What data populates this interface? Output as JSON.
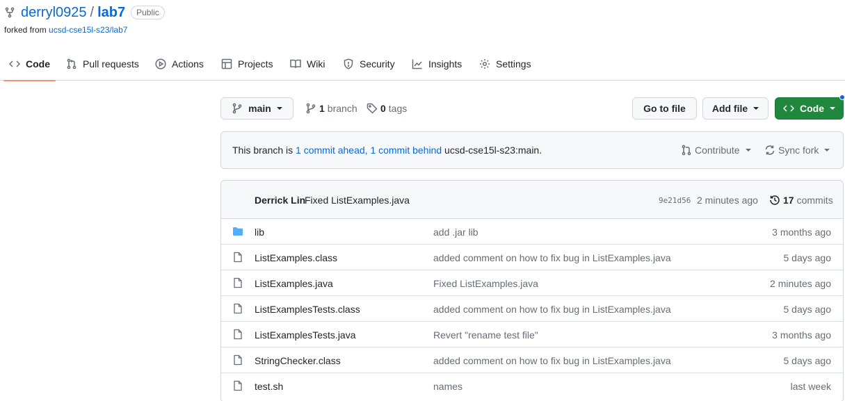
{
  "repo": {
    "owner": "derryl0925",
    "separator": "/",
    "name": "lab7",
    "visibility": "Public",
    "forked_prefix": "forked from",
    "forked_from": "ucsd-cse15l-s23/lab7"
  },
  "tabs": [
    {
      "label": "Code",
      "icon": "code-icon",
      "active": true
    },
    {
      "label": "Pull requests",
      "icon": "pull-request-icon"
    },
    {
      "label": "Actions",
      "icon": "play-icon"
    },
    {
      "label": "Projects",
      "icon": "table-icon"
    },
    {
      "label": "Wiki",
      "icon": "book-icon"
    },
    {
      "label": "Security",
      "icon": "shield-icon"
    },
    {
      "label": "Insights",
      "icon": "graph-icon"
    },
    {
      "label": "Settings",
      "icon": "gear-icon"
    }
  ],
  "toolbar": {
    "branch": "main",
    "branch_count": "1",
    "branch_label": "branch",
    "tag_count": "0",
    "tag_label": "tags",
    "go_to_file": "Go to file",
    "add_file": "Add file",
    "code": "Code"
  },
  "compare": {
    "prefix": "This branch is",
    "ahead": "1 commit ahead,",
    "behind": "1 commit behind",
    "upstream": "ucsd-cse15l-s23:main.",
    "contribute": "Contribute",
    "sync": "Sync fork"
  },
  "latest_commit": {
    "author": "Derrick Lin",
    "message": "Fixed ListExamples.java",
    "sha": "9e21d56",
    "time": "2 minutes ago",
    "commit_count": "17",
    "commit_label": "commits"
  },
  "files": [
    {
      "type": "dir",
      "name": "lib",
      "message": "add .jar lib",
      "age": "3 months ago"
    },
    {
      "type": "file",
      "name": "ListExamples.class",
      "message": "added comment on how to fix bug in ListExamples.java",
      "age": "5 days ago"
    },
    {
      "type": "file",
      "name": "ListExamples.java",
      "message": "Fixed ListExamples.java",
      "age": "2 minutes ago"
    },
    {
      "type": "file",
      "name": "ListExamplesTests.class",
      "message": "added comment on how to fix bug in ListExamples.java",
      "age": "5 days ago"
    },
    {
      "type": "file",
      "name": "ListExamplesTests.java",
      "message": "Revert \"rename test file\"",
      "age": "3 months ago"
    },
    {
      "type": "file",
      "name": "StringChecker.class",
      "message": "added comment on how to fix bug in ListExamples.java",
      "age": "5 days ago"
    },
    {
      "type": "file",
      "name": "test.sh",
      "message": "names",
      "age": "last week"
    }
  ],
  "colors": {
    "link": "#0969da",
    "green_button": "#1f883d",
    "active_tab_underline": "#fd8c73",
    "folder": "#54aeff"
  }
}
